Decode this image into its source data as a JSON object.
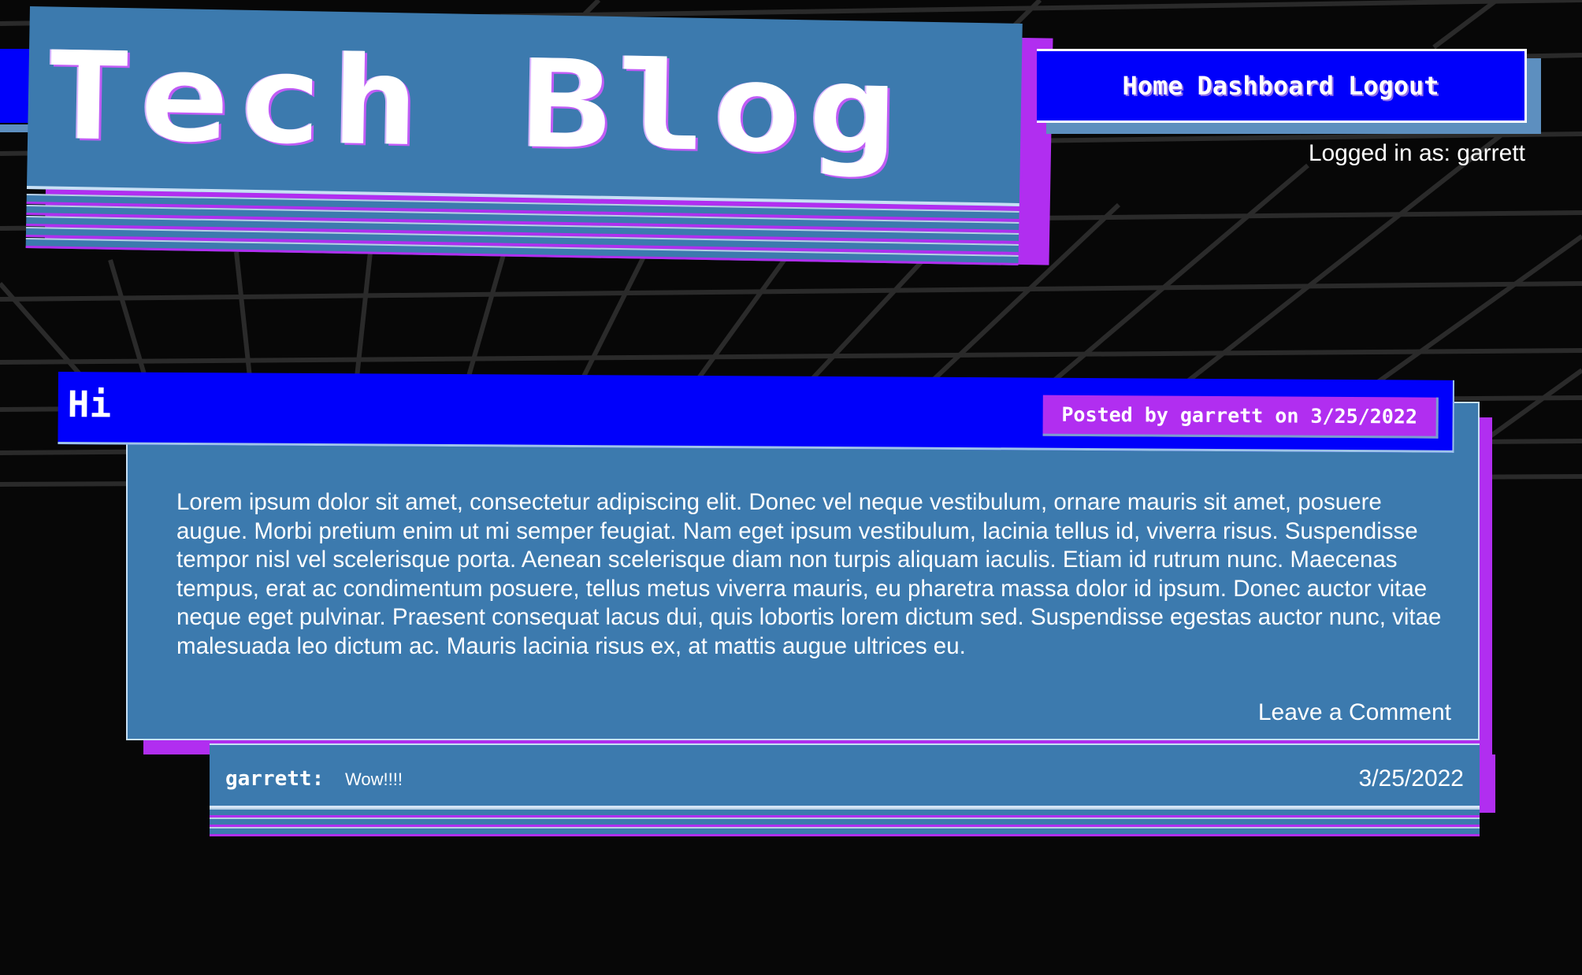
{
  "header": {
    "title": "Tech Blog",
    "logged_in_text": "Logged in as: garrett"
  },
  "nav": {
    "items": [
      {
        "label": "Home"
      },
      {
        "label": "Dashboard"
      },
      {
        "label": "Logout"
      }
    ]
  },
  "post": {
    "title": "Hi",
    "meta": "Posted by garrett on 3/25/2022",
    "content": "Lorem ipsum dolor sit amet, consectetur adipiscing elit. Donec vel neque vestibulum, ornare mauris sit amet, posuere augue. Morbi pretium enim ut mi semper feugiat. Nam eget ipsum vestibulum, lacinia tellus id, viverra risus. Suspendisse tempor nisl vel scelerisque porta. Aenean scelerisque diam non turpis aliquam iaculis. Etiam id rutrum nunc. Maecenas tempus, erat ac condimentum posuere, tellus metus viverra mauris, eu pharetra massa dolor id ipsum. Donec auctor vitae neque eget pulvinar. Praesent consequat lacus dui, quis lobortis lorem dictum sed. Suspendisse egestas auctor nunc, vitae malesuada leo dictum ac. Mauris lacinia risus ex, at mattis augue ultrices eu.",
    "leave_comment_label": "Leave a Comment"
  },
  "comments": [
    {
      "user": "garrett:",
      "text": "Wow!!!!",
      "date": "3/25/2022"
    }
  ],
  "colors": {
    "background": "#070707",
    "panel_blue": "#3c7aae",
    "accent_blue": "#0000fb",
    "accent_purple": "#b12ef0"
  }
}
